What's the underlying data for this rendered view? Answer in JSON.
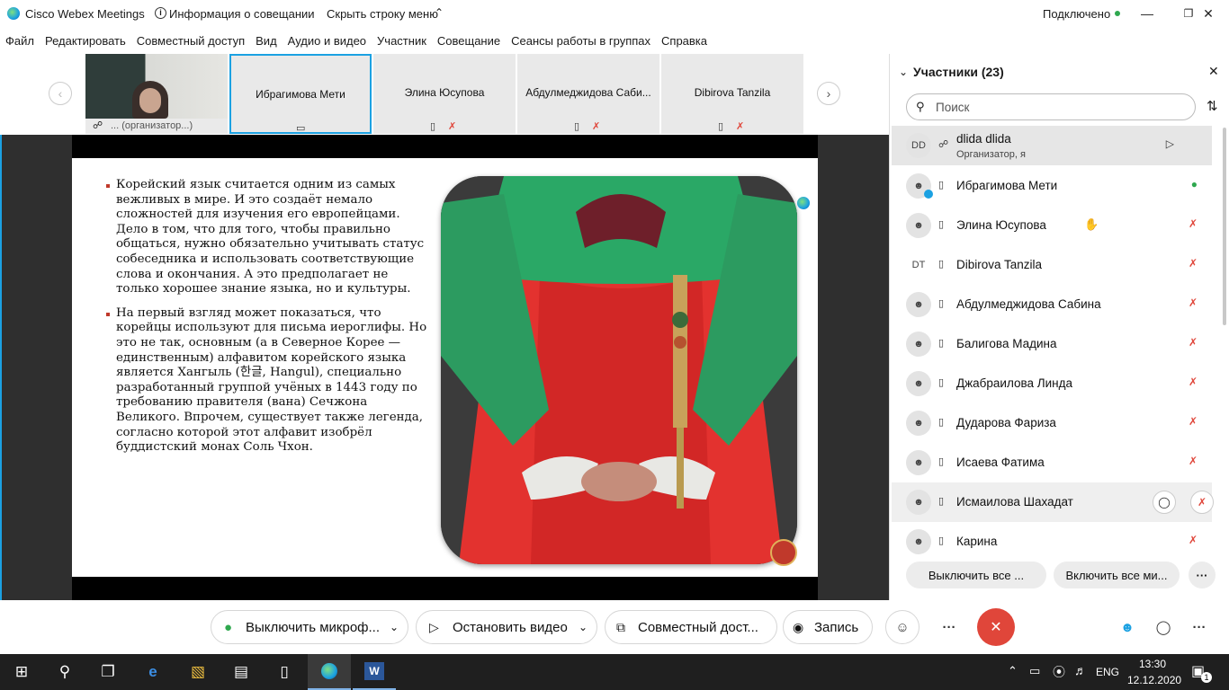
{
  "titlebar": {
    "app_title": "Cisco Webex Meetings",
    "meeting_info": "Информация о совещании",
    "hide_menu": "Скрыть строку меню",
    "status": "Подключено"
  },
  "menu": [
    "Файл",
    "Редактировать",
    "Совместный доступ",
    "Вид",
    "Аудио и видео",
    "Участник",
    "Совещание",
    "Сеансы работы в группах",
    "Справка"
  ],
  "thumbnails": [
    {
      "name": "... (организатор...)"
    },
    {
      "name": "Ибрагимова Мети"
    },
    {
      "name": "Элина Юсупова"
    },
    {
      "name": "Абдулмеджидова Саби..."
    },
    {
      "name": "Dibirova Tanzila"
    }
  ],
  "slide": {
    "paragraphs": [
      "Корейский язык считается одним из самых вежливых в мире. И это создаёт немало сложностей для изучения его европейцами. Дело в том, что для того, чтобы правильно общаться, нужно обязательно учитывать статус собеседника и использовать соответствующие слова и окончания. А это предполагает не только хорошее знание языка, но и культуры.",
      "На первый взгляд может показаться, что корейцы используют для письма иероглифы. Но это не так, основным (а в Северное Корее — единственным) алфавитом корейского языка является Хангыль (한글, Hangul), специально разработанный группой учёных в 1443 году по требованию правителя (вана) Сечжона Великого. Впрочем, существует также легенда, согласно которой этот алфавит изобрёл буддистский монах Соль Чхон."
    ]
  },
  "panel": {
    "title": "Участники (23)",
    "search_placeholder": "Поиск",
    "participants": [
      {
        "initials": "DD",
        "name": "dlida dlida",
        "sub": "Организатор, я",
        "mic": "video"
      },
      {
        "initials": "",
        "name": "Ибрагимова Мети",
        "sub": "",
        "mic": "on"
      },
      {
        "initials": "",
        "name": "Элина Юсупова",
        "sub": "",
        "mic": "muted"
      },
      {
        "initials": "DT",
        "name": "Dibirova Tanzila",
        "sub": "",
        "mic": "muted"
      },
      {
        "initials": "",
        "name": "Абдулмеджидова Сабина",
        "sub": "",
        "mic": "muted"
      },
      {
        "initials": "",
        "name": "Балигова Мадина",
        "sub": "",
        "mic": "muted"
      },
      {
        "initials": "",
        "name": "Джабраилова Линда",
        "sub": "",
        "mic": "muted"
      },
      {
        "initials": "",
        "name": "Дударова Фариза",
        "sub": "",
        "mic": "muted"
      },
      {
        "initials": "",
        "name": "Исаева Фатима",
        "sub": "",
        "mic": "muted"
      },
      {
        "initials": "",
        "name": "Исмаилова Шахадат",
        "sub": "",
        "mic": "muted"
      },
      {
        "initials": "",
        "name": "Карина",
        "sub": "",
        "mic": "muted"
      }
    ],
    "mute_all": "Выключить все ...",
    "unmute_all": "Включить все ми..."
  },
  "controls": {
    "mute": "Выключить микроф...",
    "stop_video": "Остановить видео",
    "share": "Совместный дост...",
    "record": "Запись"
  },
  "taskbar": {
    "lang": "ENG",
    "time": "13:30",
    "date": "12.12.2020",
    "notifications": "1"
  },
  "colors": {
    "accent": "#1ba1e2",
    "end_call": "#e0463a",
    "mic_on": "#2fa84f"
  }
}
